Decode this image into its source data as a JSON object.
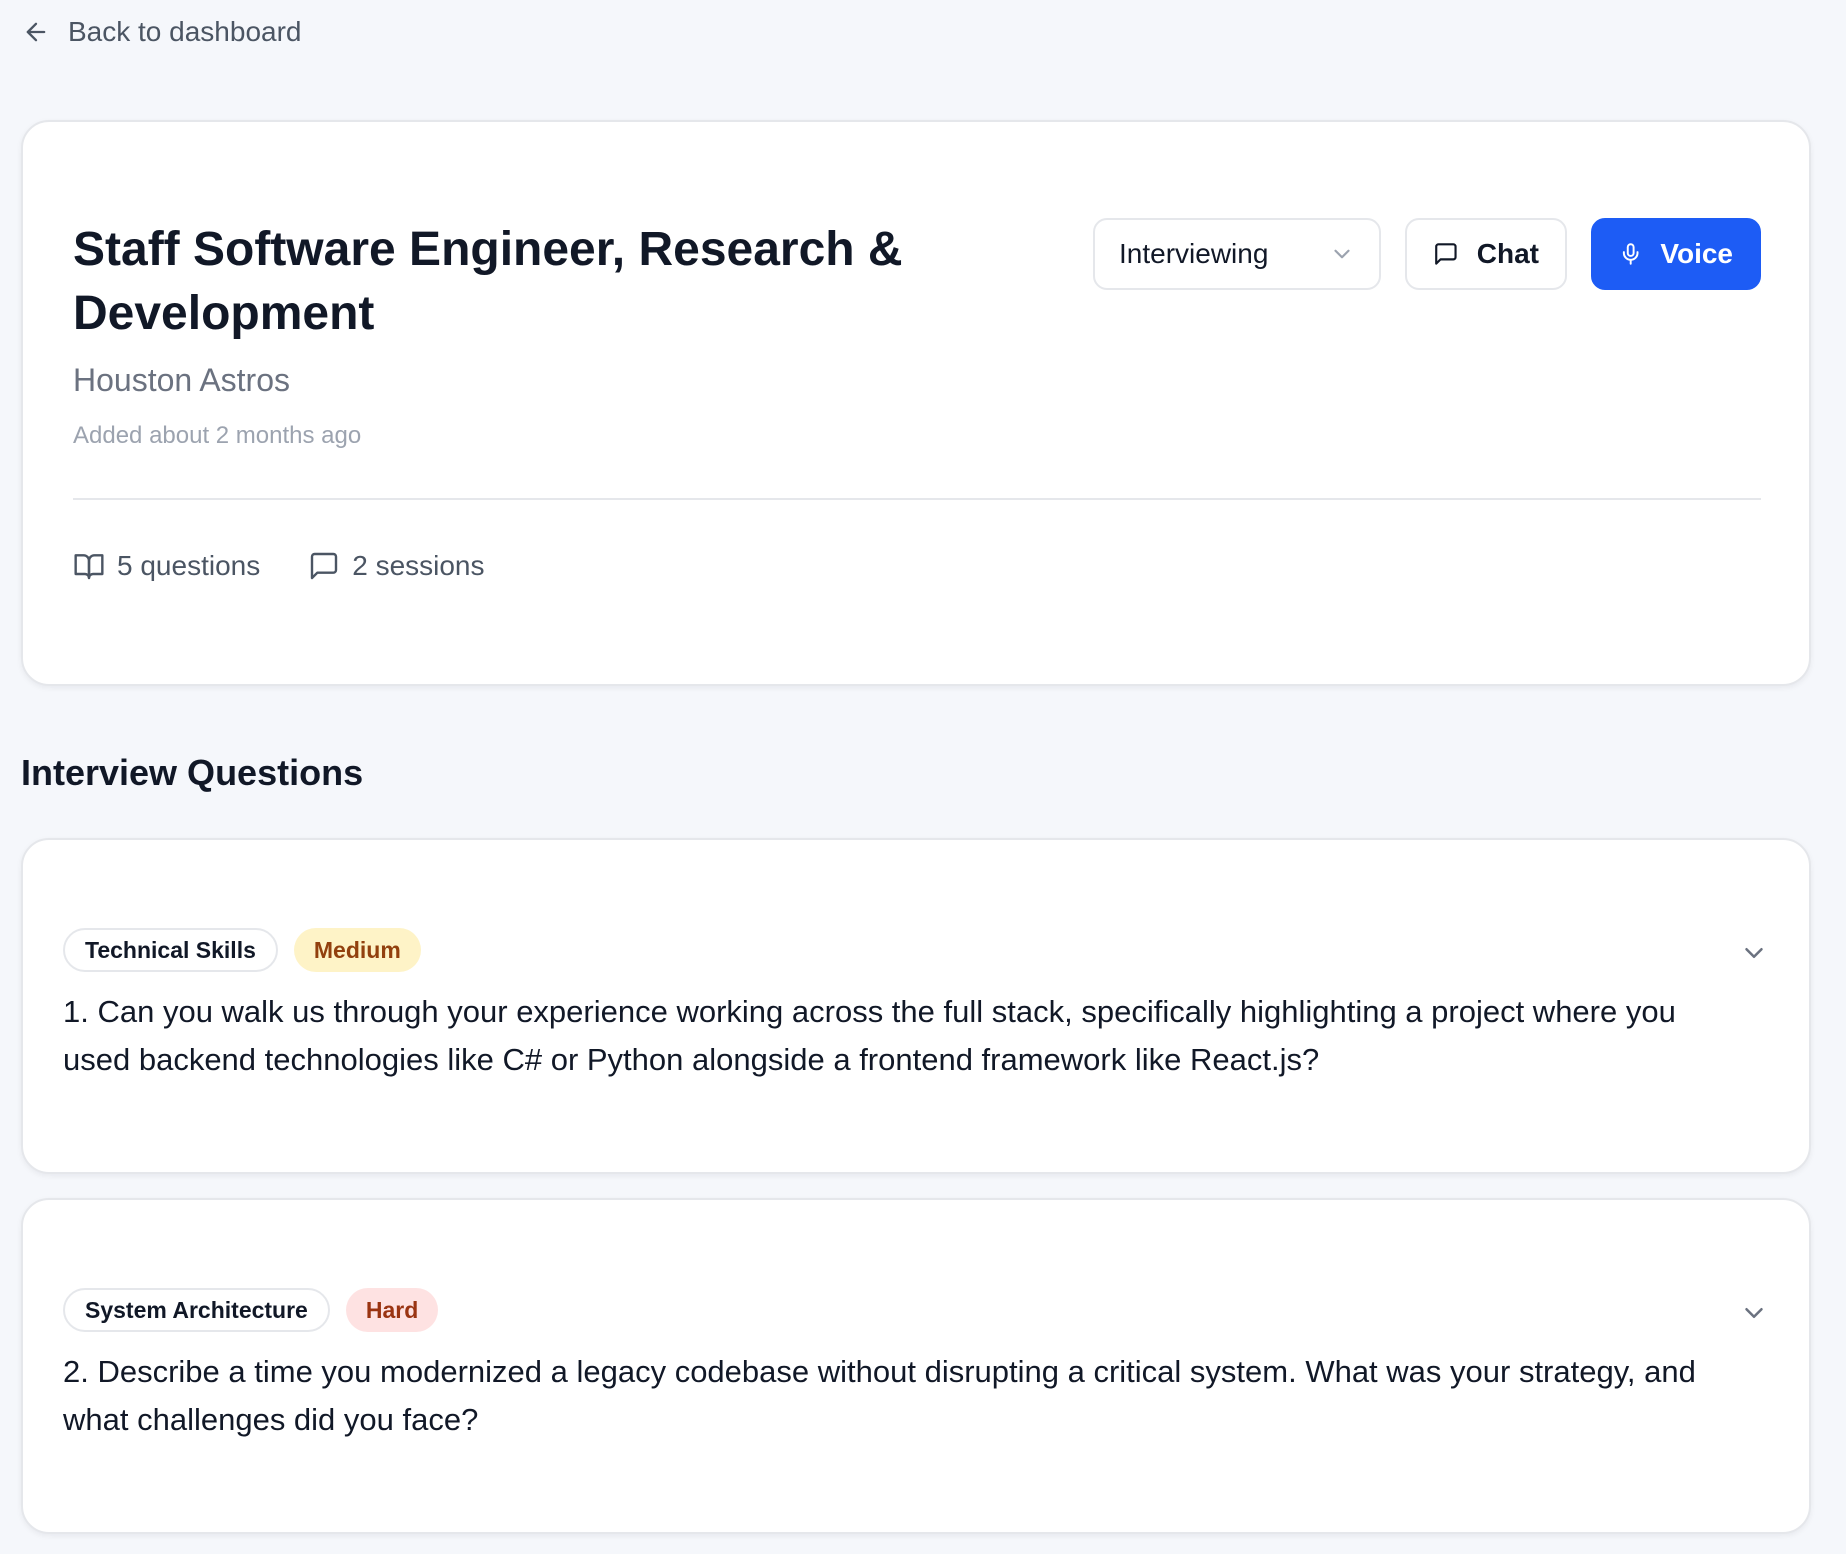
{
  "nav": {
    "back_label": "Back to dashboard"
  },
  "job": {
    "title": "Staff Software Engineer, Research & Development",
    "company": "Houston Astros",
    "added": "Added about 2 months ago",
    "status": "Interviewing",
    "chat_label": "Chat",
    "voice_label": "Voice",
    "questions_count": "5 questions",
    "sessions_count": "2 sessions"
  },
  "section": {
    "title": "Interview Questions"
  },
  "questions": [
    {
      "category": "Technical Skills",
      "difficulty": "Medium",
      "text": "1. Can you walk us through your experience working across the full stack, specifically highlighting a project where you used backend technologies like C# or Python alongside a frontend framework like React.js?"
    },
    {
      "category": "System Architecture",
      "difficulty": "Hard",
      "text": "2. Describe a time you modernized a legacy codebase without disrupting a critical system. What was your strategy, and what challenges did you face?"
    }
  ],
  "colors": {
    "accent": "#1d5cf5",
    "medium_bg": "#fef3c7",
    "medium_text": "#92400e",
    "hard_bg": "#fee2e2",
    "hard_text": "#9a3412"
  }
}
